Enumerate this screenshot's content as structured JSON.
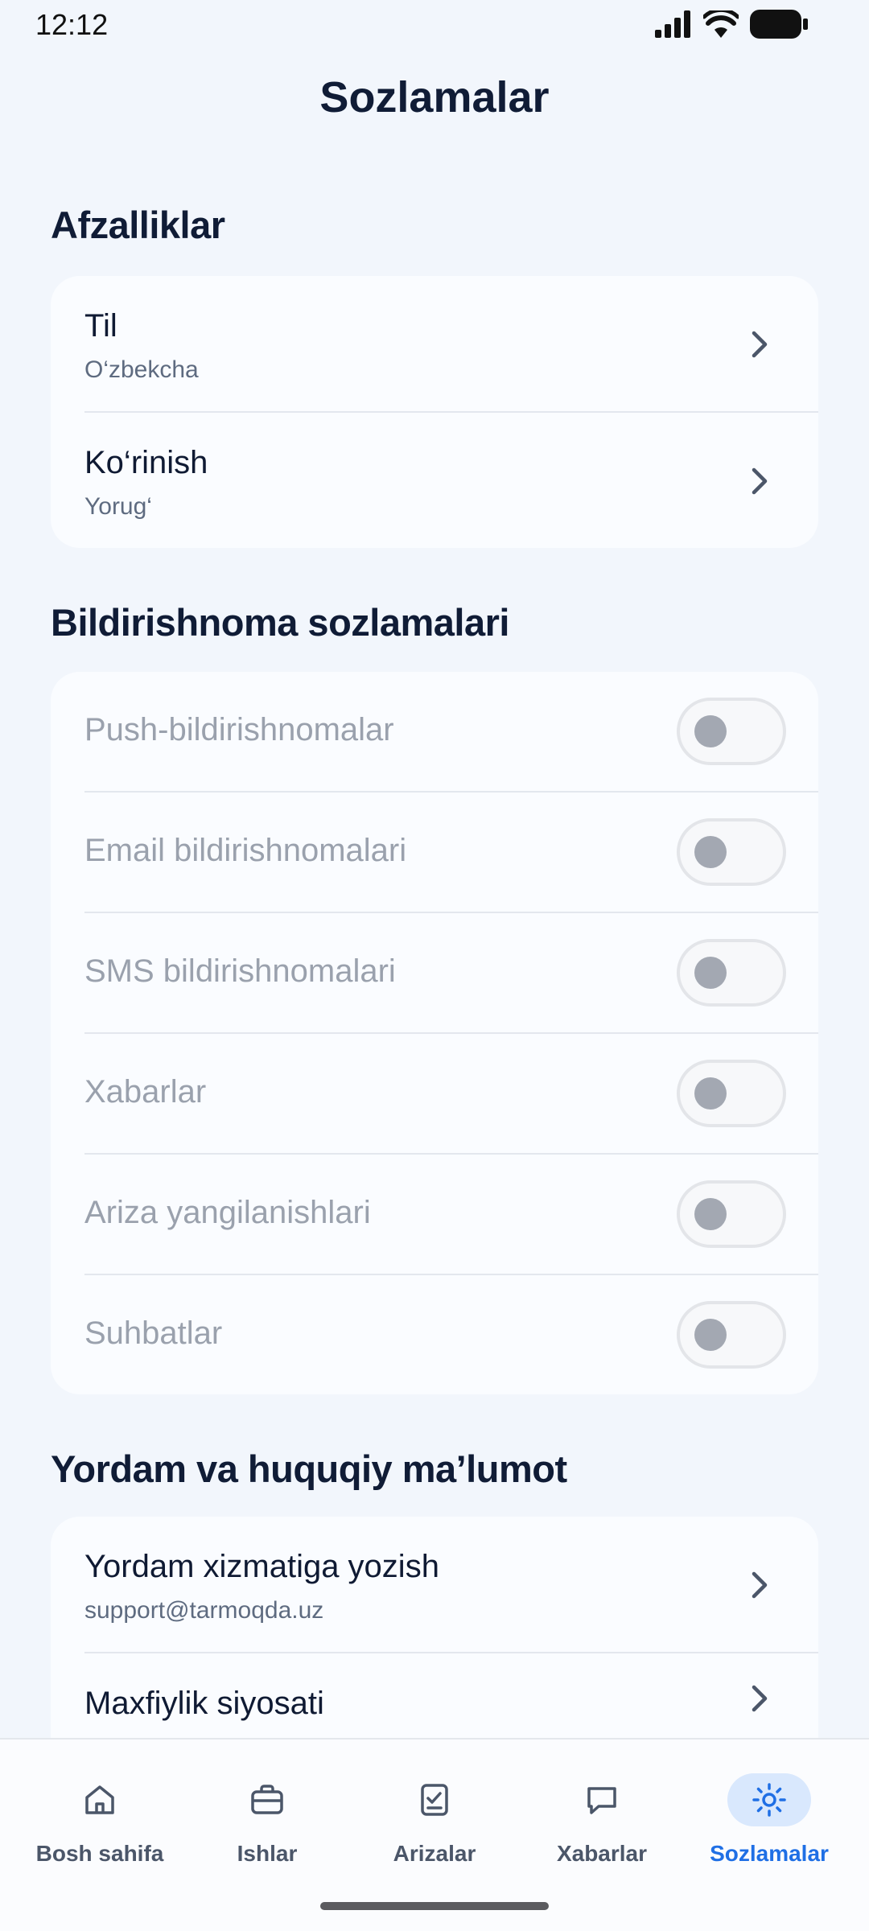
{
  "status": {
    "time": "12:12"
  },
  "header": {
    "title": "Sozlamalar"
  },
  "preferences": {
    "title": "Afzalliklar",
    "items": [
      {
        "title": "Til",
        "value": "O‘zbekcha"
      },
      {
        "title": "Ko‘rinish",
        "value": "Yorug‘"
      }
    ]
  },
  "notifications": {
    "title": "Bildirishnoma sozlamalari",
    "items": [
      {
        "label": "Push-bildirishnomalar",
        "enabled": false
      },
      {
        "label": "Email bildirishnomalari",
        "enabled": false
      },
      {
        "label": "SMS bildirishnomalari",
        "enabled": false
      },
      {
        "label": "Xabarlar",
        "enabled": false
      },
      {
        "label": "Ariza yangilanishlari",
        "enabled": false
      },
      {
        "label": "Suhbatlar",
        "enabled": false
      }
    ]
  },
  "support": {
    "title": "Yordam va huquqiy ma’lumot",
    "items": [
      {
        "title": "Yordam xizmatiga yozish",
        "value": "support@tarmoqda.uz"
      },
      {
        "title": "Maxfiylik siyosati"
      }
    ]
  },
  "bottom_nav": {
    "items": [
      {
        "label": "Bosh sahifa",
        "icon": "home-icon"
      },
      {
        "label": "Ishlar",
        "icon": "briefcase-icon"
      },
      {
        "label": "Arizalar",
        "icon": "clipboard-check-icon"
      },
      {
        "label": "Xabarlar",
        "icon": "chat-bubble-icon"
      },
      {
        "label": "Sozlamalar",
        "icon": "sun-gear-icon",
        "active": true
      }
    ]
  },
  "colors": {
    "accent": "#1f6fe5",
    "background": "#f2f6fc",
    "card": "#fafcff"
  }
}
